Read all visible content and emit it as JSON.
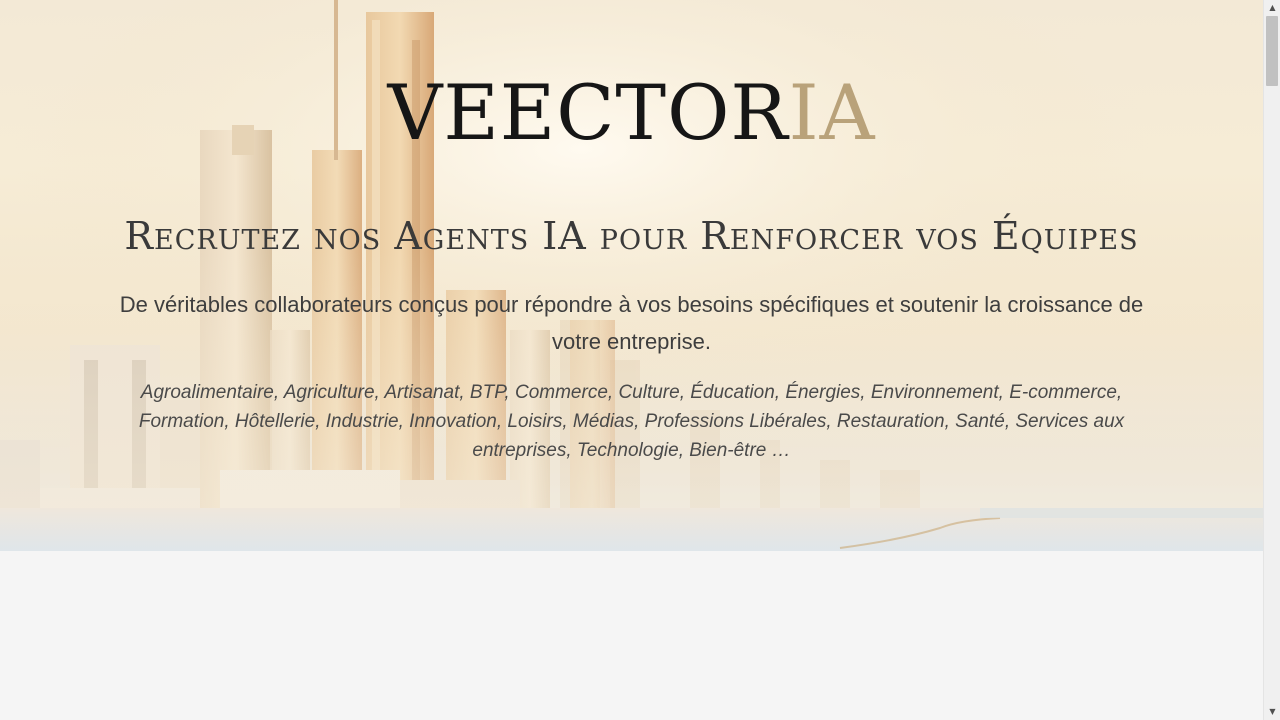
{
  "hero": {
    "logo_main": "VEECTOR",
    "logo_accent": "IA",
    "headline": "Recrutez nos Agents IA pour Renforcer vos Équipes",
    "subtitle": "De véritables collaborateurs conçus pour répondre à vos besoins spécifiques et soutenir la croissance de votre entreprise.",
    "sectors": "Agroalimentaire, Agriculture, Artisanat, BTP, Commerce, Culture, Éducation, Énergies, Environnement, E-commerce, Formation, Hôtellerie, Industrie, Innovation, Loisirs, Médias, Professions Libérales, Restauration, Santé, Services aux entreprises, Technologie, Bien-être …"
  },
  "colors": {
    "logo_dark": "#161616",
    "logo_accent": "#b9a27a",
    "text": "#3a3a3a",
    "page_background": "#f5f5f5"
  },
  "scrollbar": {
    "up_arrow_icon": "▲",
    "down_arrow_icon": "▼"
  }
}
